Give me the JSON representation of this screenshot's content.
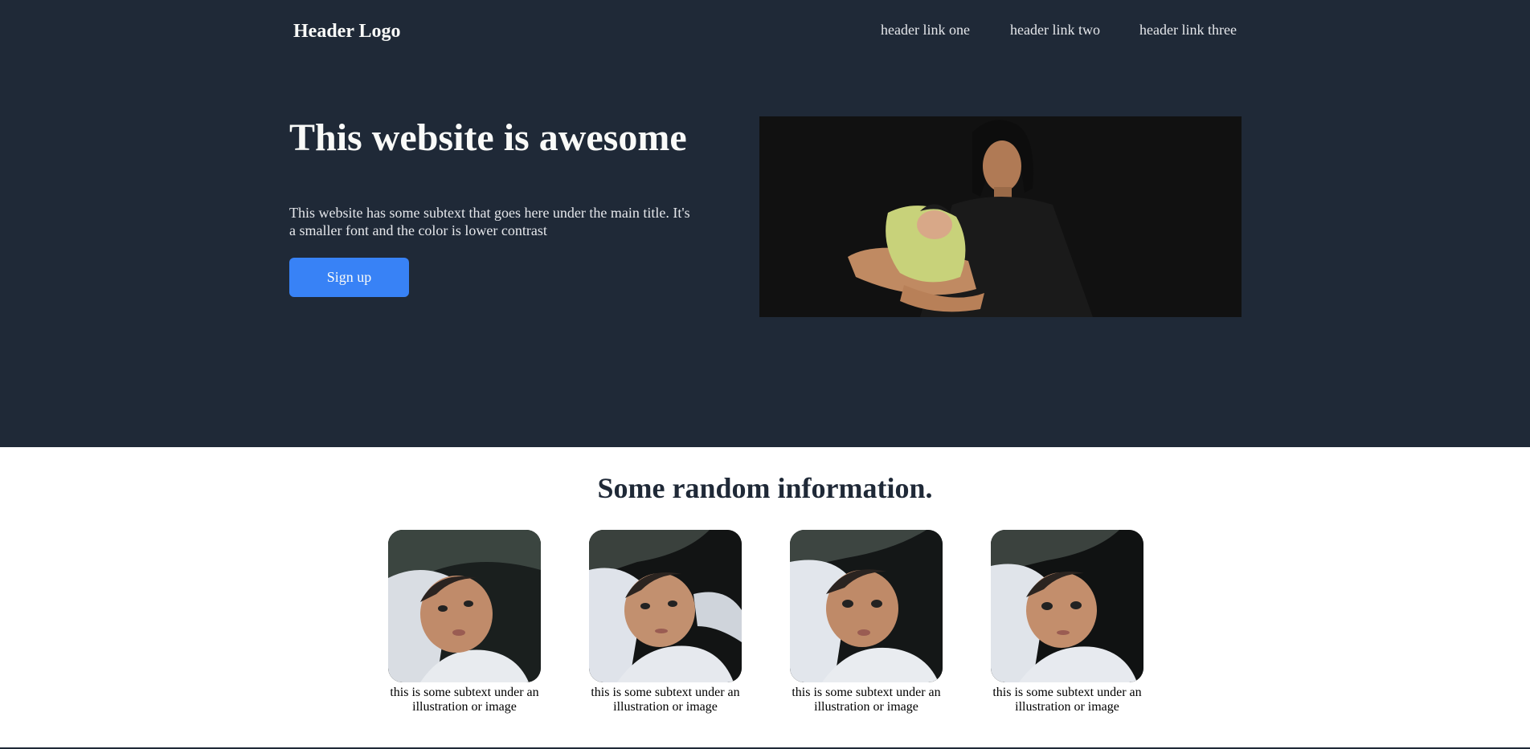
{
  "header": {
    "logo": "Header Logo",
    "links": [
      "header link one",
      "header link two",
      "header link three"
    ]
  },
  "hero": {
    "title": "This website is awesome",
    "subtext": "This website has some subtext that goes here under the main title. It's a smaller font and the color is lower contrast",
    "button_label": "Sign up"
  },
  "info": {
    "title": "Some random information.",
    "cards": [
      {
        "text": "this is some subtext under an illustration or image"
      },
      {
        "text": "this is some subtext under an illustration or image"
      },
      {
        "text": "this is some subtext under an illustration or image"
      },
      {
        "text": "this is some subtext under an illustration or image"
      }
    ]
  },
  "colors": {
    "hero_background": "#1f2937",
    "button": "#3882f6",
    "heading_light": "#f9faf8",
    "text_light": "#e5e7eb"
  }
}
